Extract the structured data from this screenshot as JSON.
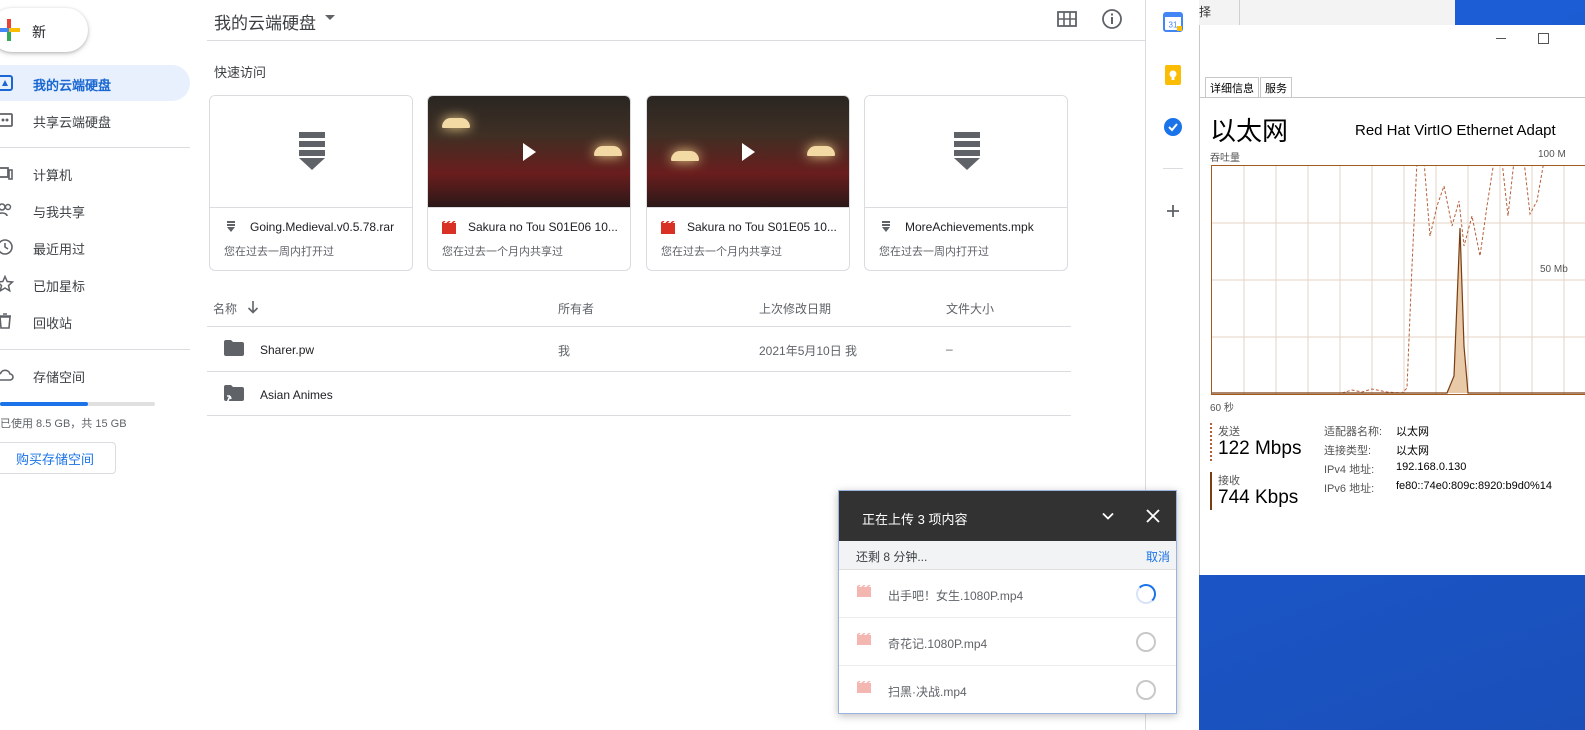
{
  "sidebar": {
    "new_label": "新",
    "items": [
      {
        "label": "我的云端硬盘"
      },
      {
        "label": "共享云端硬盘"
      },
      {
        "label": "计算机"
      },
      {
        "label": "与我共享"
      },
      {
        "label": "最近用过"
      },
      {
        "label": "已加星标"
      },
      {
        "label": "回收站"
      },
      {
        "label": "存储空间"
      }
    ],
    "storage_text": "已使用 8.5 GB，共 15 GB",
    "storage_fraction": 0.567,
    "buy_label": "购买存储空间"
  },
  "header": {
    "title": "我的云端硬盘"
  },
  "quick_access": {
    "title": "快速访问",
    "cards": [
      {
        "name": "Going.Medieval.v0.5.78.rar",
        "sub": "您在过去一周内打开过",
        "type": "archive"
      },
      {
        "name": "Sakura no Tou S01E06 10...",
        "sub": "您在过去一个月内共享过",
        "type": "video"
      },
      {
        "name": "Sakura no Tou S01E05 10...",
        "sub": "您在过去一个月内共享过",
        "type": "video"
      },
      {
        "name": "MoreAchievements.mpk",
        "sub": "您在过去一周内打开过",
        "type": "archive"
      }
    ]
  },
  "file_list": {
    "headers": {
      "name": "名称",
      "owner": "所有者",
      "modified": "上次修改日期",
      "size": "文件大小"
    },
    "rows": [
      {
        "name": "Sharer.pw",
        "owner": "我",
        "modified": "2021年5月10日 我",
        "size": "–"
      },
      {
        "name": "Asian Animes",
        "owner": "",
        "modified": "",
        "size": ""
      }
    ]
  },
  "upload": {
    "title": "正在上传 3 项内容",
    "remaining": "还剩 8 分钟...",
    "cancel": "取消",
    "items": [
      {
        "name": "出手吧！女生.1080P.mp4",
        "status": "uploading"
      },
      {
        "name": "奇花记.1080P.mp4",
        "status": "queued"
      },
      {
        "name": "扫黑·决战.mp4",
        "status": "queued"
      }
    ]
  },
  "task_manager": {
    "top_partial": "择",
    "tabs": [
      "详细信息",
      "服务"
    ],
    "adapter_title": "以太网",
    "adapter_name": "Red Hat VirtIO Ethernet Adapt",
    "throughput_label": "吞吐量",
    "max_label": "100 M",
    "mid_label": "50 Mb",
    "time_label": "60 秒",
    "send_label": "发送",
    "send_value": "122 Mbps",
    "recv_label": "接收",
    "recv_value": "744 Kbps",
    "details": [
      {
        "k": "适配器名称:",
        "v": "以太网"
      },
      {
        "k": "连接类型:",
        "v": "以太网"
      },
      {
        "k": "IPv4 地址:",
        "v": "192.168.0.130"
      },
      {
        "k": "IPv6 地址:",
        "v": "fe80::74e0:809c:8920:b9d0%14"
      }
    ]
  },
  "colors": {
    "accent": "#1a73e8",
    "active_bg": "#e8f0fe",
    "graph_line": "#a15a1f"
  }
}
